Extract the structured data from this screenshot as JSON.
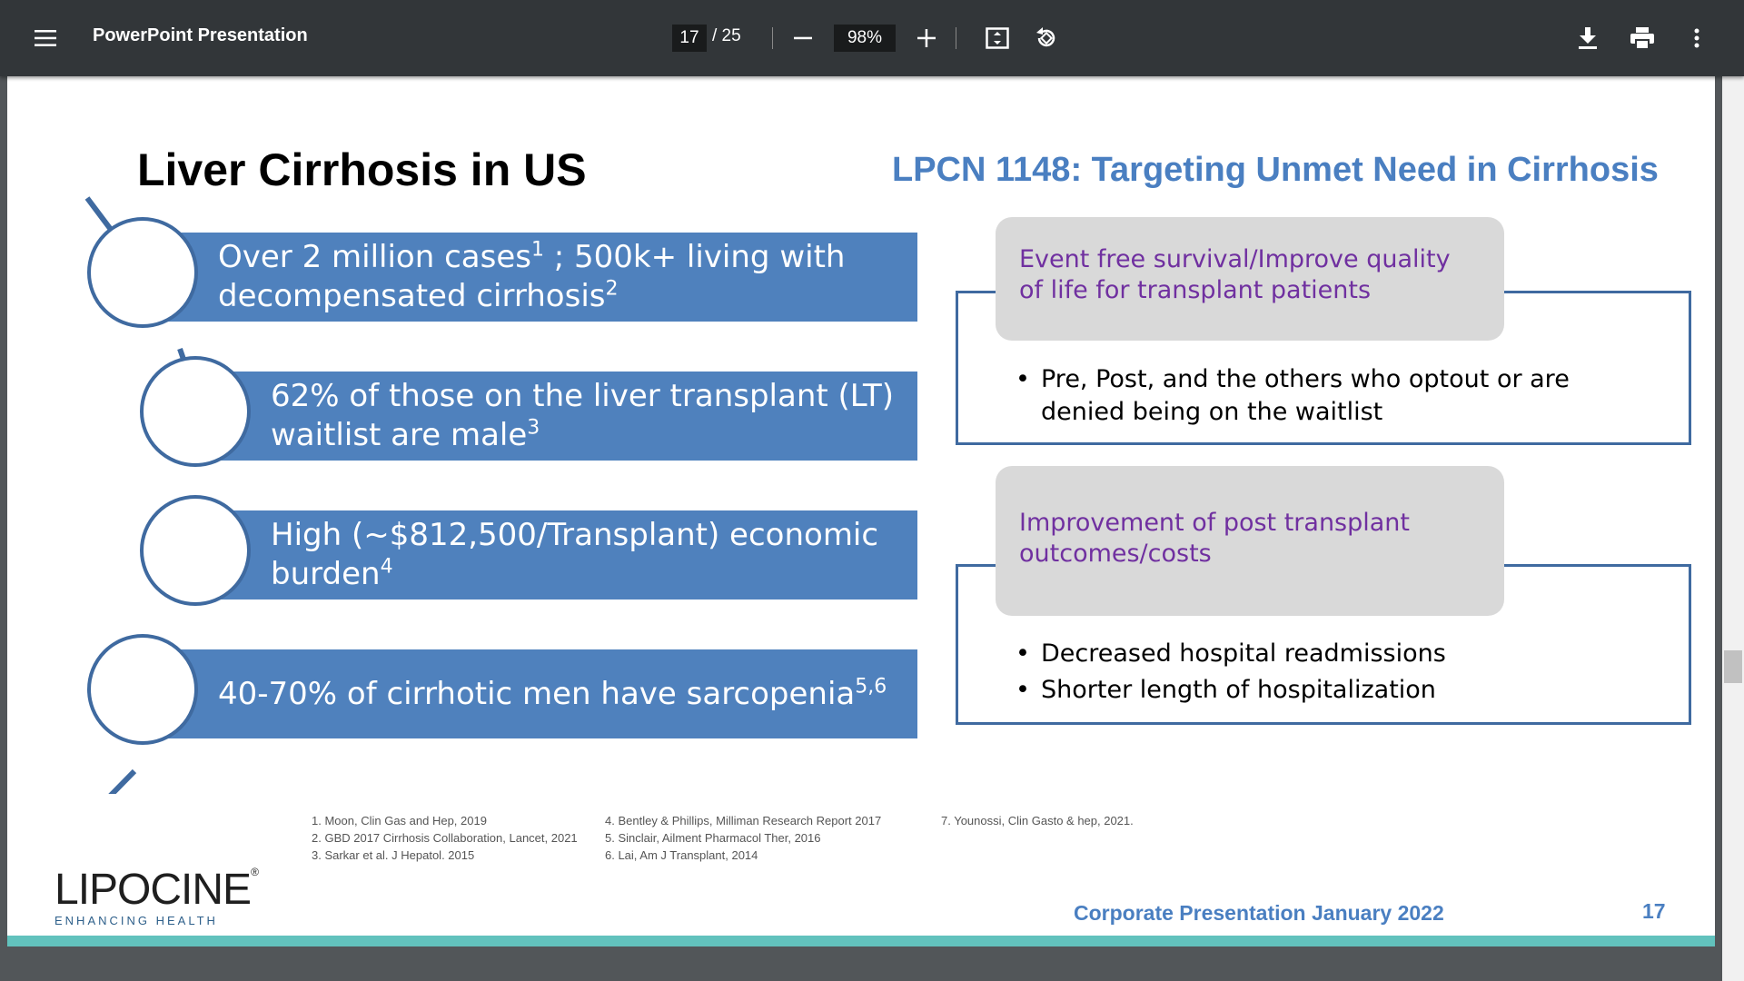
{
  "toolbar": {
    "title": "PowerPoint Presentation",
    "current_page": "17",
    "total_pages": "/ 25",
    "zoom": "98%",
    "icons": [
      "menu-icon",
      "zoom-out-icon",
      "zoom-in-icon",
      "fit-page-icon",
      "rotate-icon",
      "download-icon",
      "print-icon",
      "more-options-icon"
    ]
  },
  "slide": {
    "left_title": "Liver Cirrhosis in US",
    "right_title": "LPCN 1148: Targeting Unmet Need in Cirrhosis",
    "facts": [
      {
        "text": "Over 2 million cases",
        "sup1": "1",
        "text2": " ; 500k+ living with decompensated cirrhosis",
        "sup2": "2"
      },
      {
        "text": "62% of those on the liver transplant (LT) waitlist are male",
        "sup1": "3"
      },
      {
        "text": "High  (~$812,500/Transplant) economic burden",
        "sup1": "4"
      },
      {
        "text": "40-70% of cirrhotic men have sarcopenia",
        "sup1": "5,6"
      }
    ],
    "box1": {
      "heading": "Event free survival/Improve quality of life for transplant patients",
      "bullets": [
        "Pre, Post, and the others who optout or are denied being on the waitlist"
      ]
    },
    "box2": {
      "heading": "Improvement of post transplant outcomes/costs",
      "bullets": [
        "Decreased hospital readmissions",
        "Shorter length of hospitalization"
      ]
    },
    "references": {
      "col1": [
        "1. Moon, Clin Gas and Hep, 2019",
        "2. GBD 2017 Cirrhosis Collaboration, Lancet, 2021",
        "3. Sarkar et al. J Hepatol. 2015"
      ],
      "col2": [
        "4. Bentley & Phillips, Milliman Research Report 2017",
        "5. Sinclair, Ailment Pharmacol Ther, 2016",
        "6. Lai, Am J Transplant, 2014"
      ],
      "col3": [
        "7. Younossi, Clin Gasto & hep, 2021."
      ]
    },
    "logo_text": "LIPOCINE",
    "logo_mark": "®",
    "logo_tagline": "ENHANCING HEALTH",
    "footer": "Corporate Presentation January 2022",
    "page_number": "17"
  }
}
